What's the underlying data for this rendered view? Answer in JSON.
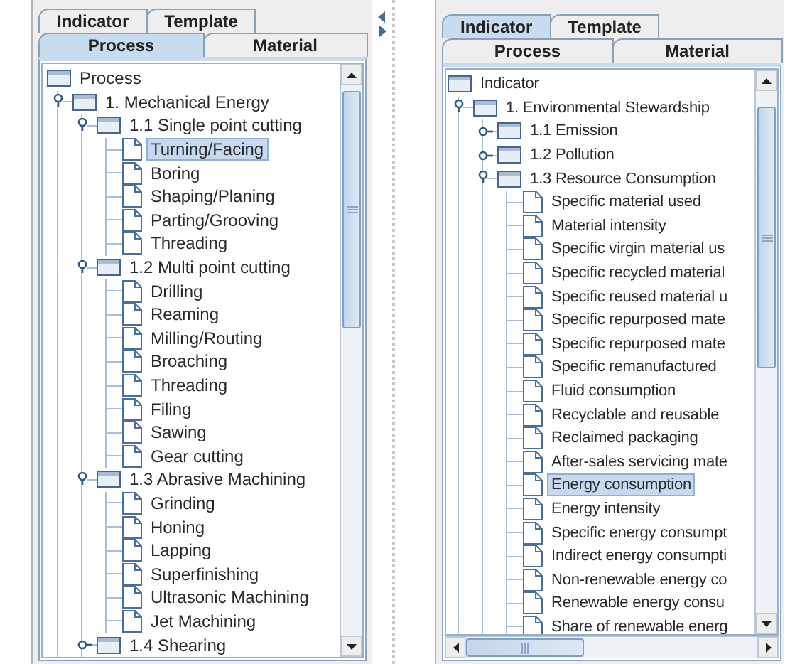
{
  "panels": [
    {
      "tab_rows": [
        {
          "tabs": [
            {
              "label": "Indicator",
              "selected": false
            },
            {
              "label": "Template",
              "selected": false
            }
          ]
        },
        {
          "tabs": [
            {
              "label": "Process",
              "selected": true
            },
            {
              "label": "Material",
              "selected": false
            }
          ]
        }
      ],
      "horizontal_scrollbar": false,
      "tree": {
        "label": "Process",
        "kind": "folder",
        "selected": false,
        "children": [
          {
            "label": "1. Mechanical Energy",
            "kind": "folder",
            "expanded": true,
            "selected": false,
            "children": [
              {
                "label": "1.1 Single point cutting",
                "kind": "folder",
                "expanded": true,
                "selected": false,
                "children": [
                  {
                    "label": "Turning/Facing",
                    "kind": "leaf",
                    "selected": true
                  },
                  {
                    "label": "Boring",
                    "kind": "leaf",
                    "selected": false
                  },
                  {
                    "label": "Shaping/Planing",
                    "kind": "leaf",
                    "selected": false
                  },
                  {
                    "label": "Parting/Grooving",
                    "kind": "leaf",
                    "selected": false
                  },
                  {
                    "label": "Threading",
                    "kind": "leaf",
                    "selected": false
                  }
                ]
              },
              {
                "label": "1.2 Multi point cutting",
                "kind": "folder",
                "expanded": true,
                "selected": false,
                "children": [
                  {
                    "label": "Drilling",
                    "kind": "leaf",
                    "selected": false
                  },
                  {
                    "label": "Reaming",
                    "kind": "leaf",
                    "selected": false
                  },
                  {
                    "label": "Milling/Routing",
                    "kind": "leaf",
                    "selected": false
                  },
                  {
                    "label": "Broaching",
                    "kind": "leaf",
                    "selected": false
                  },
                  {
                    "label": "Threading",
                    "kind": "leaf",
                    "selected": false
                  },
                  {
                    "label": "Filing",
                    "kind": "leaf",
                    "selected": false
                  },
                  {
                    "label": "Sawing",
                    "kind": "leaf",
                    "selected": false
                  },
                  {
                    "label": "Gear cutting",
                    "kind": "leaf",
                    "selected": false
                  }
                ]
              },
              {
                "label": "1.3 Abrasive Machining",
                "kind": "folder",
                "expanded": true,
                "selected": false,
                "children": [
                  {
                    "label": "Grinding",
                    "kind": "leaf",
                    "selected": false
                  },
                  {
                    "label": "Honing",
                    "kind": "leaf",
                    "selected": false
                  },
                  {
                    "label": "Lapping",
                    "kind": "leaf",
                    "selected": false
                  },
                  {
                    "label": "Superfinishing",
                    "kind": "leaf",
                    "selected": false
                  },
                  {
                    "label": "Ultrasonic Machining",
                    "kind": "leaf",
                    "selected": false
                  },
                  {
                    "label": "Jet Machining",
                    "kind": "leaf",
                    "selected": false
                  }
                ]
              },
              {
                "label": "1.4 Shearing",
                "kind": "folder",
                "expanded": false,
                "selected": false
              }
            ]
          }
        ]
      }
    },
    {
      "tab_rows": [
        {
          "tabs": [
            {
              "label": "Indicator",
              "selected": true
            },
            {
              "label": "Template",
              "selected": false
            }
          ]
        },
        {
          "tabs": [
            {
              "label": "Process",
              "selected": false
            },
            {
              "label": "Material",
              "selected": false
            }
          ]
        }
      ],
      "horizontal_scrollbar": true,
      "tree": {
        "label": "Indicator",
        "kind": "folder",
        "selected": false,
        "children": [
          {
            "label": "1. Environmental Stewardship",
            "kind": "folder",
            "expanded": true,
            "selected": false,
            "children": [
              {
                "label": "1.1 Emission",
                "kind": "folder",
                "expanded": false,
                "selected": false
              },
              {
                "label": "1.2 Pollution",
                "kind": "folder",
                "expanded": false,
                "selected": false
              },
              {
                "label": "1.3 Resource Consumption",
                "kind": "folder",
                "expanded": true,
                "selected": false,
                "children": [
                  {
                    "label": "Specific material used",
                    "kind": "leaf",
                    "selected": false
                  },
                  {
                    "label": "Material intensity",
                    "kind": "leaf",
                    "selected": false
                  },
                  {
                    "label": "Specific virgin material us",
                    "kind": "leaf",
                    "selected": false
                  },
                  {
                    "label": "Specific recycled material",
                    "kind": "leaf",
                    "selected": false
                  },
                  {
                    "label": "Specific reused material u",
                    "kind": "leaf",
                    "selected": false
                  },
                  {
                    "label": "Specific repurposed mate",
                    "kind": "leaf",
                    "selected": false
                  },
                  {
                    "label": "Specific repurposed mate",
                    "kind": "leaf",
                    "selected": false
                  },
                  {
                    "label": "Specific remanufactured",
                    "kind": "leaf",
                    "selected": false
                  },
                  {
                    "label": "Fluid consumption",
                    "kind": "leaf",
                    "selected": false
                  },
                  {
                    "label": "Recyclable and reusable",
                    "kind": "leaf",
                    "selected": false
                  },
                  {
                    "label": "Reclaimed packaging",
                    "kind": "leaf",
                    "selected": false
                  },
                  {
                    "label": "After-sales servicing mate",
                    "kind": "leaf",
                    "selected": false
                  },
                  {
                    "label": "Energy consumption",
                    "kind": "leaf",
                    "selected": true
                  },
                  {
                    "label": "Energy intensity",
                    "kind": "leaf",
                    "selected": false
                  },
                  {
                    "label": "Specific energy consumpt",
                    "kind": "leaf",
                    "selected": false
                  },
                  {
                    "label": "Indirect energy consumpti",
                    "kind": "leaf",
                    "selected": false
                  },
                  {
                    "label": "Non-renewable energy co",
                    "kind": "leaf",
                    "selected": false
                  },
                  {
                    "label": "Renewable energy consu",
                    "kind": "leaf",
                    "selected": false
                  },
                  {
                    "label": "Share of renewable energ",
                    "kind": "leaf",
                    "selected": false
                  }
                ]
              }
            ]
          }
        ]
      }
    }
  ]
}
